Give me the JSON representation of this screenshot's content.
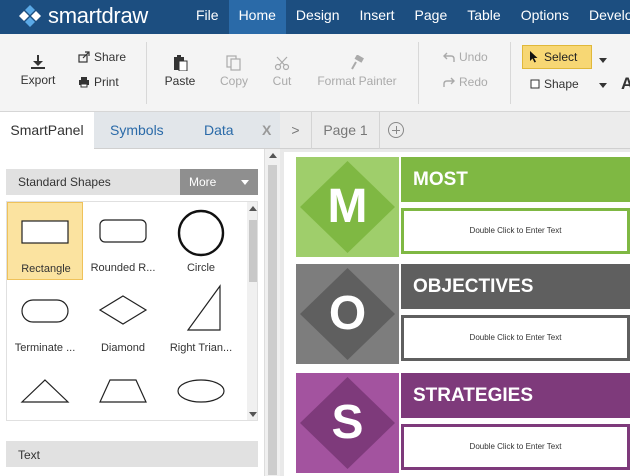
{
  "app": {
    "logo_text": "smartdraw"
  },
  "colors": {
    "nav": "#1c4e80",
    "nav_active": "#2a6aa8",
    "m_light": "#9fce6b",
    "m_dark": "#7fb843",
    "o_light": "#7d7d7d",
    "o_dark": "#5f5f5f",
    "s_light": "#a3539f",
    "s_dark": "#7e3a7b"
  },
  "menu": [
    "File",
    "Home",
    "Design",
    "Insert",
    "Page",
    "Table",
    "Options",
    "Develo"
  ],
  "ribbon": {
    "export": "Export",
    "share": "Share",
    "print": "Print",
    "paste": "Paste",
    "copy": "Copy",
    "cut": "Cut",
    "format_painter": "Format Painter",
    "undo": "Undo",
    "redo": "Redo",
    "select": "Select",
    "shape": "Shape",
    "cut_off_letter": "A"
  },
  "panel": {
    "tabs": [
      "SmartPanel",
      "Symbols",
      "Data"
    ],
    "close": "X",
    "section_title": "Standard Shapes",
    "more": "More",
    "shapes": [
      {
        "name": "Rectangle",
        "icon": "rectangle-icon"
      },
      {
        "name": "Rounded R...",
        "icon": "rounded-rectangle-icon"
      },
      {
        "name": "Circle",
        "icon": "circle-icon"
      },
      {
        "name": "Terminate ...",
        "icon": "terminator-icon"
      },
      {
        "name": "Diamond",
        "icon": "diamond-icon"
      },
      {
        "name": "Right Trian...",
        "icon": "right-triangle-icon"
      },
      {
        "name": "",
        "icon": "triangle-icon"
      },
      {
        "name": "",
        "icon": "trapezoid-icon"
      },
      {
        "name": "",
        "icon": "ellipse-icon"
      }
    ],
    "text_section": "Text"
  },
  "doc_tabs": {
    "nav": ">",
    "page": "Page 1"
  },
  "diagram": [
    {
      "letter": "M",
      "title": "MOST",
      "body": "Double Click to Enter Text"
    },
    {
      "letter": "O",
      "title": "OBJECTIVES",
      "body": "Double Click to Enter Text"
    },
    {
      "letter": "S",
      "title": "STRATEGIES",
      "body": "Double Click to Enter Text"
    }
  ]
}
